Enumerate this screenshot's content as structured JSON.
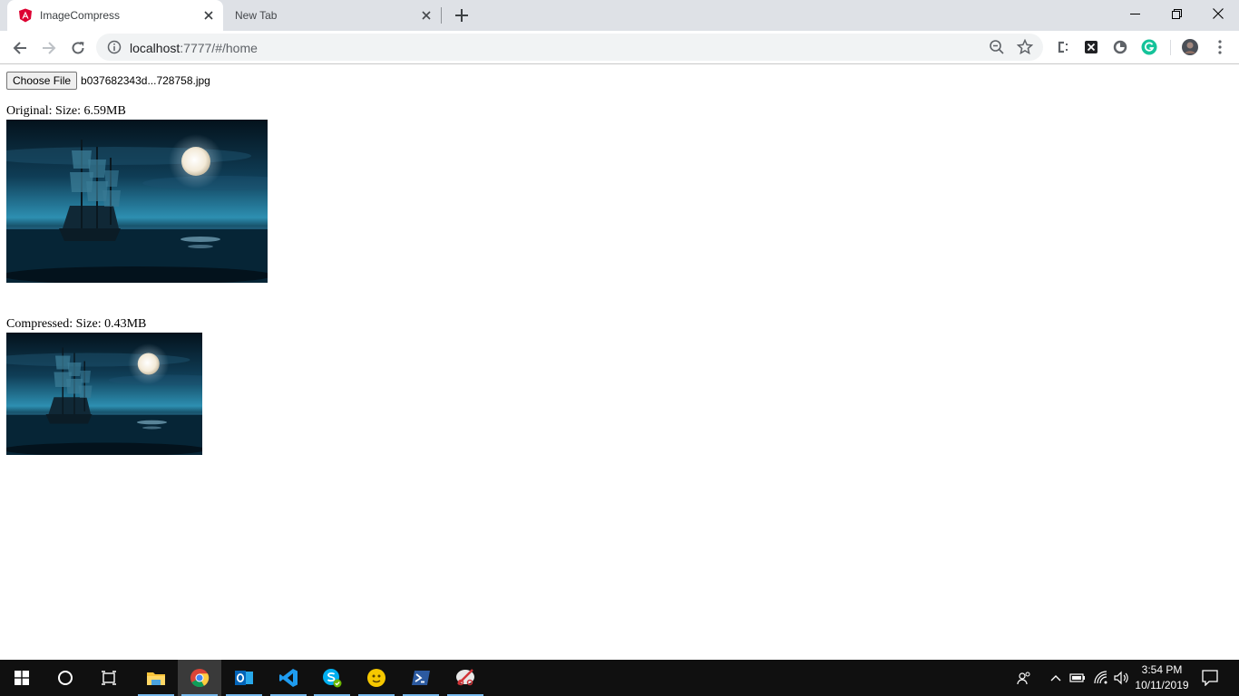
{
  "browser": {
    "tabs": [
      {
        "title": "ImageCompress",
        "active": true,
        "favicon": "angular-icon"
      },
      {
        "title": "New Tab",
        "active": false
      }
    ],
    "url": {
      "host": "localhost",
      "rest": ":7777/#/home"
    }
  },
  "page": {
    "file_input": {
      "button_label": "Choose File",
      "file_name": "b037682343d...728758.jpg"
    },
    "original": {
      "label": "Original: Size: 6.59MB"
    },
    "compressed": {
      "label": "Compressed: Size: 0.43MB"
    }
  },
  "taskbar": {
    "apps": [
      "start-icon",
      "cortana-icon",
      "task-view-icon",
      "file-explorer-icon",
      "chrome-icon",
      "outlook-icon",
      "vscode-icon",
      "skype-icon",
      "sticker-app-icon",
      "powershell-icon",
      "snipping-tool-icon"
    ],
    "time": "3:54 PM",
    "date": "10/11/2019"
  },
  "colors": {
    "tab_strip": "#dee1e6",
    "omnibox": "#f1f3f4",
    "taskbar": "#101010",
    "accent_taskbar": "#76b9ed",
    "angular_red": "#dd0031"
  }
}
